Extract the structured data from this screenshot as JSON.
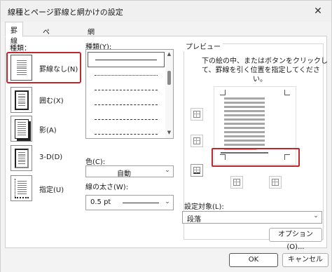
{
  "window": {
    "title": "線種とページ罫線と網かけの設定",
    "close_glyph": "✕"
  },
  "tabs": [
    {
      "label": "罫線",
      "active": true
    },
    {
      "label": "ページ罫線",
      "active": false
    },
    {
      "label": "網かけ",
      "active": false
    }
  ],
  "presets": {
    "label": "種類：",
    "items": [
      {
        "label": "罫線なし(N)",
        "icon": "no-border-icon",
        "selected": true
      },
      {
        "label": "囲む(X)",
        "icon": "box-border-icon",
        "selected": false
      },
      {
        "label": "影(A)",
        "icon": "shadow-border-icon",
        "selected": false
      },
      {
        "label": "3-D(D)",
        "icon": "3d-border-icon",
        "selected": false
      },
      {
        "label": "指定(U)",
        "icon": "custom-border-icon",
        "selected": false
      }
    ],
    "highlight_color": "#c0262d"
  },
  "style": {
    "label": "種類(Y):",
    "options": [
      "solid",
      "dotted",
      "dashed",
      "dashed-long",
      "dash-dot",
      "dash-dot-dot"
    ],
    "selected_index": 0
  },
  "color": {
    "label": "色(C):",
    "value": "自動"
  },
  "width": {
    "label": "線の太さ(W):",
    "value": "0.5 pt"
  },
  "preview": {
    "label": "プレビュー",
    "hint_line1": "下の絵の中、またはボタンをクリックし",
    "hint_line2": "て、罫線を引く位置を指定してくださ",
    "hint_line3": "い。",
    "bottom_border_selected": true
  },
  "apply_to": {
    "label": "設定対象(L):",
    "value": "段落"
  },
  "buttons": {
    "options": "オプション(O)...",
    "ok": "OK",
    "cancel": "キャンセル"
  },
  "colors": {
    "highlight": "#c0262d",
    "dialog_bg": "#f3f3f3",
    "panel_bg": "#ffffff"
  }
}
